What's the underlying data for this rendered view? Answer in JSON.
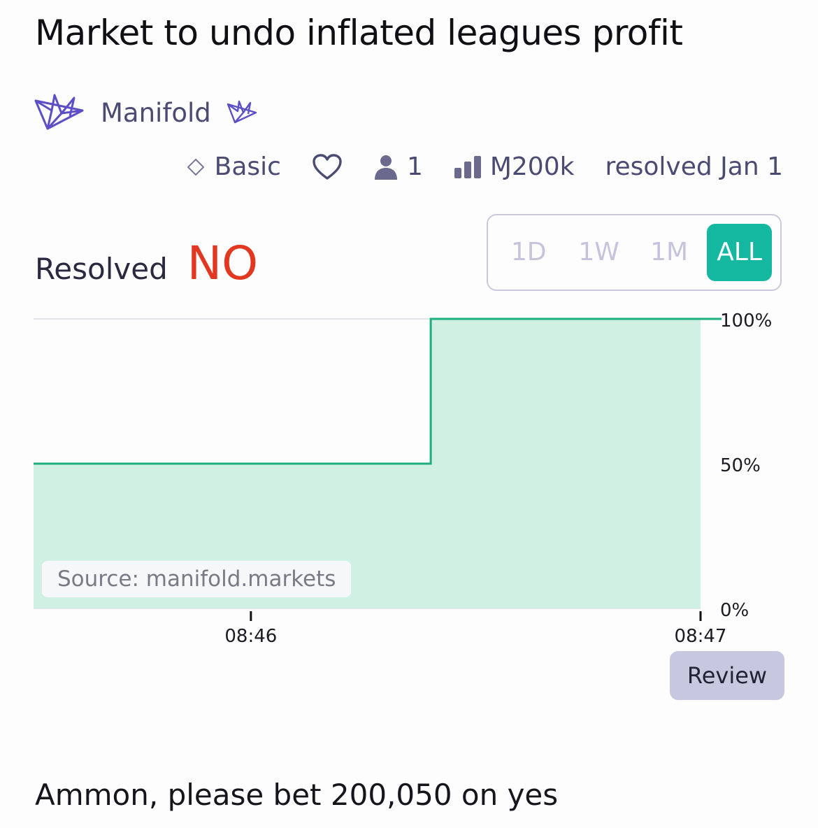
{
  "title": "Market to undo inflated leagues profit",
  "creator": {
    "name": "Manifold",
    "avatar_icon": "manifold-crane-logo",
    "badge_icon": "manifold-crown-badge"
  },
  "meta": {
    "tier_icon": "diamond-outline-icon",
    "tier": "Basic",
    "like_icon": "heart-outline-icon",
    "traders_icon": "person-icon",
    "traders": "1",
    "volume_icon": "bar-chart-icon",
    "volume": "Ɱ200k",
    "resolved_date": "resolved Jan 1"
  },
  "resolution": {
    "label": "Resolved",
    "value": "NO",
    "value_color": "#e2381f"
  },
  "time_range": {
    "options": [
      "1D",
      "1W",
      "1M",
      "ALL"
    ],
    "selected": "ALL"
  },
  "accent_color": "#14b8a0",
  "source_label": "Source: manifold.markets",
  "review_label": "Review",
  "description": "Ammon, please bet 200,050 on yes",
  "chart_data": {
    "type": "area",
    "y_ticks": [
      "100%",
      "50%",
      "0%"
    ],
    "x_ticks": [
      "08:46",
      "08:47"
    ],
    "series": [
      {
        "points": [
          {
            "x": "08:45:31",
            "y": 50
          },
          {
            "x": "08:46:24",
            "y": 50
          },
          {
            "x": "08:46:24",
            "y": 100
          },
          {
            "x": "08:47:00",
            "y": 100
          }
        ]
      }
    ],
    "ylim": [
      0,
      100
    ],
    "grid": true,
    "line_color": "#1fae80",
    "fill_color": "#d0f0e4"
  }
}
